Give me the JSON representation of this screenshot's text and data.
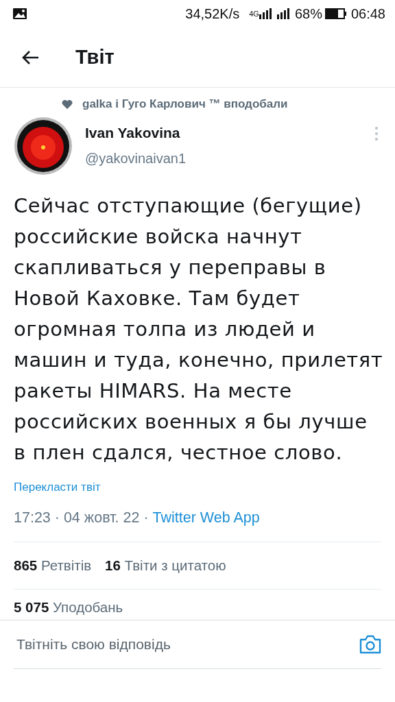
{
  "status_bar": {
    "speed": "34,52K/s",
    "network": "4G",
    "battery": "68%",
    "time": "06:48"
  },
  "header": {
    "title": "Твіт"
  },
  "social_context": {
    "text": "galka і Гуго Карлович ™ вподобали"
  },
  "tweet": {
    "author": "Ivan Yakovina",
    "handle": "@yakovinaivan1",
    "text": "Сейчас отступающие (бегущие) российские войска начнут скапливаться у переправы в Новой Каховке. Там будет огромная толпа из людей и машин и туда, конечно, прилетят ракеты HIMARS. На месте российских военных я бы лучше в плен сдался, честное слово.",
    "translate": "Перекласти твіт",
    "time": "17:23 · 04 жовт. 22 · ",
    "source": "Twitter Web App"
  },
  "stats": [
    {
      "count": "865",
      "label": "Ретвітів"
    },
    {
      "count": "16",
      "label": "Твіти з цитатою"
    }
  ],
  "likes": {
    "count": "5 075",
    "label": "Уподобань"
  },
  "reply": {
    "placeholder": "Твітніть свою відповідь"
  }
}
